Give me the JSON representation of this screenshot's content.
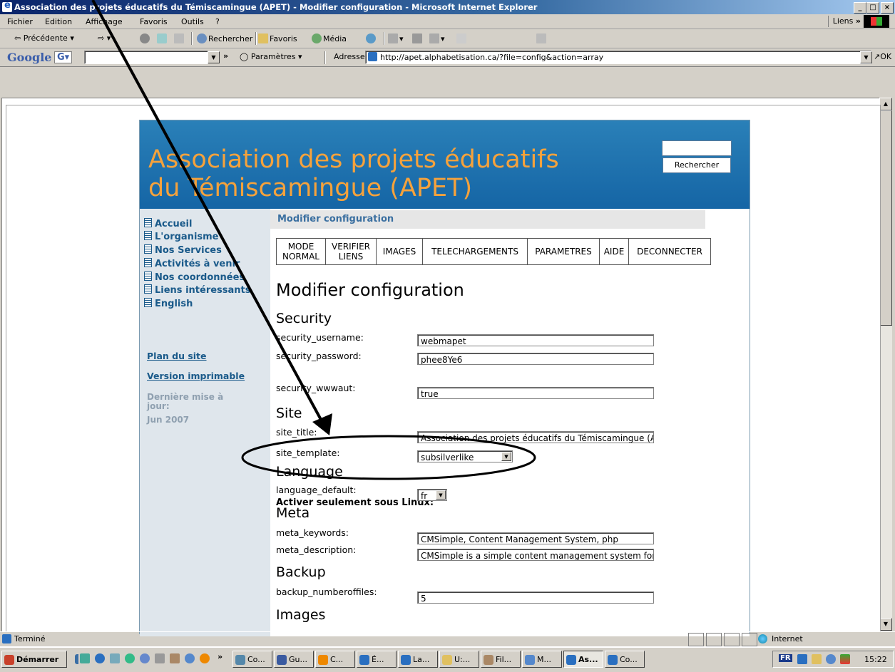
{
  "window": {
    "title": "Association des projets éducatifs du Témiscamingue (APET) - Modifier configuration - Microsoft Internet Explorer"
  },
  "menu": {
    "items": [
      "Fichier",
      "Edition",
      "Affichage",
      "Favoris",
      "Outils",
      "?"
    ],
    "links_label": "Liens",
    "links_chevron": "»"
  },
  "toolbar": {
    "back": "Précédente",
    "search": "Rechercher",
    "favorites": "Favoris",
    "media": "Média"
  },
  "googlebar": {
    "logo": "Google",
    "g_button": "G",
    "chevron": "»",
    "params": "Paramètres"
  },
  "address": {
    "label": "Adresse",
    "url": "http://apet.alphabetisation.ca/?file=config&action=array",
    "go": "OK"
  },
  "site": {
    "title_line1": "Association des projets éducatifs",
    "title_line2": "du Témiscamingue (APET)",
    "search_button": "Rechercher",
    "nav": [
      "Accueil",
      "L'organisme",
      "Nos Services",
      "Activités à venir",
      "Nos coordonnées",
      "Liens intéressants",
      "English"
    ],
    "sitemap": "Plan du site",
    "printable": "Version imprimable",
    "last_update_label": "Dernière mise à jour:",
    "last_update_date": "Jun 2007"
  },
  "admin": {
    "subheading": "Modifier configuration",
    "tabs": [
      "MODE NORMAL",
      "VERIFIER LIENS",
      "IMAGES",
      "TELECHARGEMENTS",
      "PARAMETRES",
      "AIDE",
      "DECONNECTER"
    ],
    "heading": "Modifier configuration",
    "sections": {
      "security": "Security",
      "site": "Site",
      "language": "Language",
      "meta": "Meta",
      "backup": "Backup",
      "images": "Images"
    },
    "fields": {
      "security_username": {
        "label": "security_username:",
        "value": "webmapet"
      },
      "security_password": {
        "label": "security_password:",
        "value": "phee8Ye6"
      },
      "linux_notice": "Activer seulement sous Linux:",
      "security_wwwaut": {
        "label": "security_wwwaut:",
        "value": "true"
      },
      "site_title": {
        "label": "site_title:",
        "value": "Association des projets éducatifs du Témiscamingue (AF"
      },
      "site_template": {
        "label": "site_template:",
        "value": "subsilverlike"
      },
      "language_default": {
        "label": "language_default:",
        "value": "fr"
      },
      "meta_keywords": {
        "label": "meta_keywords:",
        "value": "CMSimple, Content Management System, php"
      },
      "meta_description": {
        "label": "meta_description:",
        "value": "CMSimple is a simple content management system for sm"
      },
      "backup_numberoffiles": {
        "label": "backup_numberoffiles:",
        "value": "5"
      }
    }
  },
  "status": {
    "text": "Terminé",
    "zone": "Internet"
  },
  "taskbar": {
    "start": "Démarrer",
    "chevron": "»",
    "buttons": [
      "Co...",
      "Gu...",
      "C...",
      "É...",
      "La...",
      "U:...",
      "Fil...",
      "M...",
      "As...",
      "Co..."
    ],
    "lang": "FR",
    "clock": "15:22"
  },
  "colors": {
    "accent_orange": "#f5a23c",
    "banner_blue": "#1a6faf",
    "nav_blue": "#1a5a8a"
  }
}
